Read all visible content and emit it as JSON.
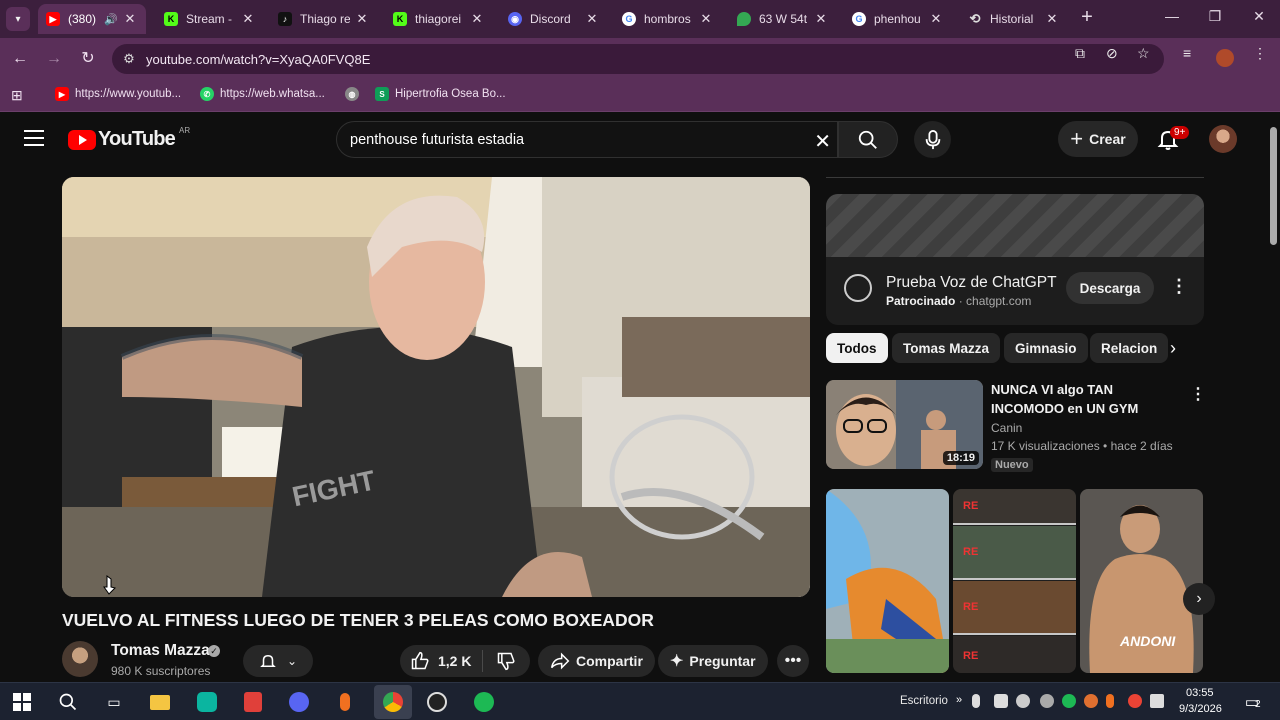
{
  "browser": {
    "tabs": [
      {
        "title": "(380)",
        "favicon": "youtube-icon",
        "color": "#ff0000",
        "active": true
      },
      {
        "title": "Stream - ",
        "favicon": "kick-icon",
        "color": "#53fc18"
      },
      {
        "title": "Thiago re",
        "favicon": "tiktok-icon",
        "color": "#111111"
      },
      {
        "title": "thiagorei",
        "favicon": "kick-icon",
        "color": "#53fc18"
      },
      {
        "title": "Discord",
        "favicon": "discord-icon",
        "color": "#5865f2"
      },
      {
        "title": "hombros",
        "favicon": "google-icon",
        "color": "#4285f4"
      },
      {
        "title": "63 W 54t",
        "favicon": "maps-icon",
        "color": "#34a853"
      },
      {
        "title": "phenhou",
        "favicon": "google-icon",
        "color": "#4285f4"
      },
      {
        "title": "Historial",
        "favicon": "history-icon",
        "color": "#cccccc"
      }
    ],
    "url": "youtube.com/watch?v=XyaQA0FVQ8E",
    "bookmarks": [
      {
        "label": "https://www.youtub...",
        "icon": "youtube-icon",
        "color": "#ff0000"
      },
      {
        "label": "https://web.whatsa...",
        "icon": "whatsapp-icon",
        "color": "#25d366"
      },
      {
        "label": "",
        "icon": "globe-icon",
        "color": "#bbbbbb"
      },
      {
        "label": "Hipertrofia Osea Bo...",
        "icon": "sheets-icon",
        "color": "#0f9d58"
      }
    ]
  },
  "youtube": {
    "logo_country": "AR",
    "logo_text": "YouTube",
    "search_query": "penthouse futurista estadia",
    "create_label": "Crear",
    "notifications": "9+",
    "video": {
      "title": "VUELVO AL FITNESS LUEGO DE TENER 3 PELEAS COMO BOXEADOR",
      "channel": "Tomas Mazza",
      "subscribers": "980 K suscriptores",
      "likes": "1,2 K",
      "share_label": "Compartir",
      "ask_label": "Preguntar"
    },
    "ad": {
      "title": "Prueba Voz de ChatGPT",
      "sponsored": "Patrocinado",
      "domain": "chatgpt.com",
      "cta": "Descarga"
    },
    "chips": [
      "Todos",
      "Tomas Mazza",
      "Gimnasio",
      "Relacion"
    ],
    "recommendation": {
      "title": "NUNCA VI algo TAN INCOMODO en UN GYM",
      "channel": "Canin",
      "meta": "17 K visualizaciones • hace 2 días",
      "badge": "Nuevo",
      "duration": "18:19"
    },
    "shorts": [
      {
        "overlay": ""
      },
      {
        "overlay": ""
      },
      {
        "overlay": "ANDONI"
      }
    ]
  },
  "taskbar": {
    "desktop_label": "Escritorio",
    "time": "03:55",
    "date": "9/3/2026",
    "notification_count": "2"
  }
}
